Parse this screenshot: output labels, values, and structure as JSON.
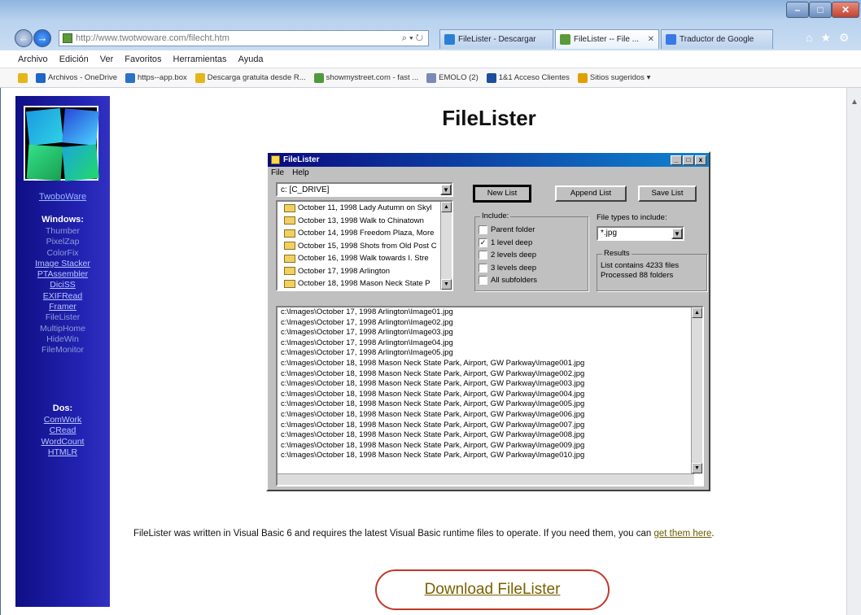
{
  "browser": {
    "address": "http://www.twotwoware.com/filecht.htm",
    "address_tools": "⌕ ▾ ↻",
    "tabs": [
      {
        "label": "FileLister - Descargar"
      },
      {
        "label": "FileLister -- File ..."
      },
      {
        "label": "Traductor de Google"
      }
    ],
    "window_buttons": [
      "–",
      "□",
      "✕"
    ],
    "corner_icons": [
      "⌂",
      "★",
      "⚙"
    ],
    "menu": [
      "Archivo",
      "Edición",
      "Ver",
      "Favoritos",
      "Herramientas",
      "Ayuda"
    ],
    "favorites": [
      {
        "label": "Archivos - OneDrive",
        "color": "#1e66c8"
      },
      {
        "label": "https--app.box",
        "color": "#2a72c8"
      },
      {
        "label": "Descarga gratuita desde R...",
        "color": "#e6b51a"
      },
      {
        "label": "showmystreet.com - fast ...",
        "color": "#4f9a3c"
      },
      {
        "label": "EMOLO (2)",
        "color": "#7a8ab8"
      },
      {
        "label": "1&1 Acceso Clientes",
        "color": "#1b4f9a"
      },
      {
        "label": "Sitios sugeridos ▾",
        "color": "#e0a000"
      }
    ]
  },
  "sidebar": {
    "title": "TwoboWare",
    "windows_heading": "Windows:",
    "windows_items": [
      {
        "label": "Thumber",
        "dim": true
      },
      {
        "label": "PixelZap",
        "dim": true
      },
      {
        "label": "ColorFix",
        "dim": true
      },
      {
        "label": "Image Stacker",
        "dim": false
      },
      {
        "label": "PTAssembler",
        "dim": false
      },
      {
        "label": "DiciSS",
        "dim": false
      },
      {
        "label": "EXIFRead",
        "dim": false
      },
      {
        "label": "Framer",
        "dim": false
      },
      {
        "label": "FileLister",
        "dim": true
      },
      {
        "label": "MultipHome",
        "dim": true
      },
      {
        "label": "HideWin",
        "dim": true
      },
      {
        "label": "FileMonitor",
        "dim": true
      }
    ],
    "dos_heading": "Dos:",
    "dos_items": [
      {
        "label": "ComWork"
      },
      {
        "label": "CRead"
      },
      {
        "label": "WordCount"
      },
      {
        "label": "HTMLR"
      }
    ]
  },
  "page": {
    "title": "FileLister",
    "description": "FileLister was written in Visual Basic 6 and requires the latest Visual Basic runtime files to operate. If you need them, you can",
    "get_link": "get them here",
    "period": ".",
    "download": "Download FileLister"
  },
  "app": {
    "title": "FileLister",
    "menu": [
      "File",
      "Help"
    ],
    "drive": "c: [C_DRIVE]",
    "folders": [
      "October 11, 1998 Lady Autumn on Skyl",
      "October 13, 1998 Walk to Chinatown",
      "October 14, 1998 Freedom Plaza, More",
      "October 15, 1998 Shots from Old Post C",
      "October 16, 1998 Walk towards I. Stre",
      "October 17, 1998 Arlington",
      "October 18, 1998 Mason Neck State P"
    ],
    "buttons": {
      "new": "New List",
      "append": "Append List",
      "save": "Save List"
    },
    "include_label": "Include:",
    "include_options": [
      {
        "label": "Parent folder",
        "checked": false
      },
      {
        "label": "1 level deep",
        "checked": true
      },
      {
        "label": "2 levels deep",
        "checked": false
      },
      {
        "label": "3 levels deep",
        "checked": false
      },
      {
        "label": "All subfolders",
        "checked": false
      }
    ],
    "filetypes_label": "File types to include:",
    "filetype_value": "*.jpg",
    "results_label": "Results",
    "results_text": "List contains 4233 files\nProcessed 88 folders",
    "paths": [
      "c:\\Images\\October 17, 1998 Arlington\\Image01.jpg",
      "c:\\Images\\October 17, 1998 Arlington\\Image02.jpg",
      "c:\\Images\\October 17, 1998 Arlington\\Image03.jpg",
      "c:\\Images\\October 17, 1998 Arlington\\Image04.jpg",
      "c:\\Images\\October 17, 1998 Arlington\\Image05.jpg",
      "c:\\Images\\October 18, 1998 Mason Neck State Park, Airport, GW Parkway\\Image001.jpg",
      "c:\\Images\\October 18, 1998 Mason Neck State Park, Airport, GW Parkway\\Image002.jpg",
      "c:\\Images\\October 18, 1998 Mason Neck State Park, Airport, GW Parkway\\Image003.jpg",
      "c:\\Images\\October 18, 1998 Mason Neck State Park, Airport, GW Parkway\\Image004.jpg",
      "c:\\Images\\October 18, 1998 Mason Neck State Park, Airport, GW Parkway\\Image005.jpg",
      "c:\\Images\\October 18, 1998 Mason Neck State Park, Airport, GW Parkway\\Image006.jpg",
      "c:\\Images\\October 18, 1998 Mason Neck State Park, Airport, GW Parkway\\Image007.jpg",
      "c:\\Images\\October 18, 1998 Mason Neck State Park, Airport, GW Parkway\\Image008.jpg",
      "c:\\Images\\October 18, 1998 Mason Neck State Park, Airport, GW Parkway\\Image009.jpg",
      "c:\\Images\\October 18, 1998 Mason Neck State Park, Airport, GW Parkway\\Image010.jpg"
    ]
  },
  "colors": {
    "sidebar": "#1a1aa0",
    "download_ring": "#c0392b",
    "link": "#6a5a00"
  }
}
